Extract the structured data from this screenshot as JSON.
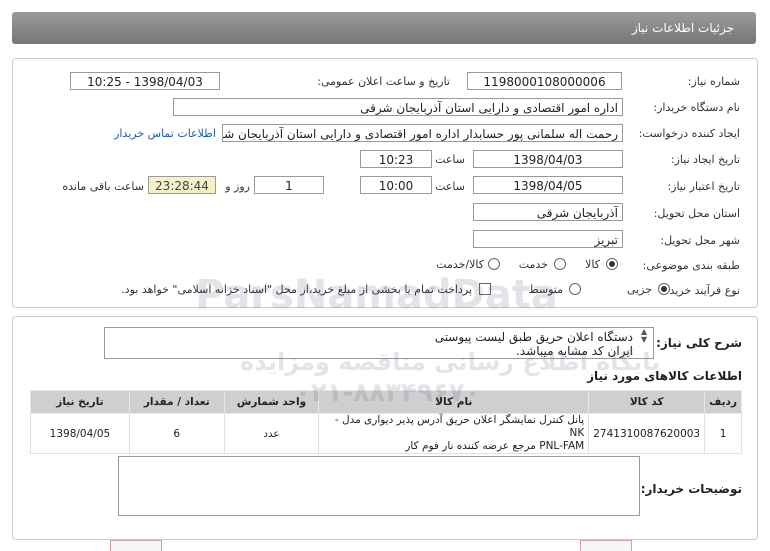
{
  "header": {
    "title": "جزئیات اطلاعات نیاز"
  },
  "form": {
    "need_number": {
      "label": "شماره نیاز:",
      "value": "1198000108000006"
    },
    "announce_datetime": {
      "label": "تاریخ و ساعت اعلان عمومی:",
      "value": "1398/04/03 - 10:25"
    },
    "buyer_org": {
      "label": "نام دستگاه خریدار:",
      "value": "اداره امور اقتصادی و دارایی استان آذربایجان شرقی"
    },
    "requester": {
      "label": "ایجاد کننده درخواست:",
      "value": "رحمت اله سلمانی پور حسابدار اداره امور اقتصادی و دارایی استان آذربایجان شرق",
      "link": "اطلاعات تماس خریدار"
    },
    "created": {
      "label": "تاریخ ایجاد نیاز:",
      "date": "1398/04/03",
      "time_label": "ساعت",
      "time": "10:23"
    },
    "validity": {
      "label": "تاریخ اعتبار نیاز:",
      "date": "1398/04/05",
      "time_label": "ساعت",
      "time": "10:00",
      "days": "1",
      "days_label": "روز و",
      "remaining": "23:28:44",
      "remaining_label": "ساعت باقی مانده"
    },
    "province": {
      "label": "استان محل تحویل:",
      "value": "آذربایجان شرقی"
    },
    "city": {
      "label": "شهر محل تحویل:",
      "value": "تبریز"
    },
    "category": {
      "label": "طبقه بندی موضوعی:",
      "options": [
        "کالا",
        "خدمت",
        "کالا/خدمت"
      ],
      "selected": "کالا"
    },
    "process": {
      "label": "نوع فرآیند خرید :",
      "options": [
        "جزیی",
        "متوسط"
      ],
      "selected": "جزیی",
      "checkbox_text": "پرداخت تمام یا بخشی از مبلغ خرید،از محل \"اسناد خزانه اسلامی\" خواهد بود."
    }
  },
  "description": {
    "label": "شرح کلی نیاز:",
    "line1": "دستگاه اعلان حریق طبق لیست پیوستی",
    "line2": "ایران کد مشابه میباشد."
  },
  "items": {
    "title": "اطلاعات کالاهای مورد نیاز",
    "headers": [
      "ردیف",
      "کد کالا",
      "نام کالا",
      "واحد شمارش",
      "تعداد / مقدار",
      "تاریخ نیاز"
    ],
    "rows": [
      {
        "row": "1",
        "code": "2741310087620003",
        "name_line1": "پانل کنترل نمایشگر اعلان حریق آدرس پذیر دیواری مدل -NK",
        "name_line2": "PNL-FAM مرجع عرضه کننده نار فوم کار",
        "unit": "عدد",
        "qty": "6",
        "date": "1398/04/05"
      }
    ]
  },
  "buyer_notes": {
    "label": "توضیحات خریدار:",
    "value": ""
  },
  "watermark": {
    "line1": "ParsNamadData",
    "line2": "پایگاه اطلاع رسانی مناقصه ومزایده",
    "line3": "۰۲۱-۸۸۳۴۹۶۷۰"
  },
  "colors": {
    "header_bg": "#888888",
    "link": "#1a5bb5",
    "table_header": "#cfcfcf",
    "yellow_field": "#f4f0c8"
  }
}
